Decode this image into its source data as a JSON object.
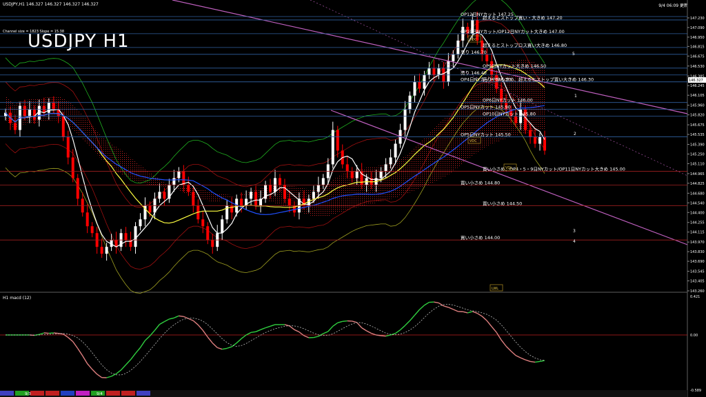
{
  "header": {
    "symbol_line": "USDJPY,H1  146.327 146.327 146.327 146.327",
    "clock": "9/4 06:09 更新",
    "channel_info": "Channel size = 1823 Slope = 15.38",
    "title": "USDJPY H1"
  },
  "macd": {
    "label": "H1  macd (12)",
    "ticks": [
      "0.421",
      "0.00",
      "-0.589"
    ]
  },
  "dates": [
    "9/3",
    "9/4"
  ],
  "colors": {
    "bg": "#000000",
    "bull": "#ffffff",
    "bear": "#ff0000",
    "ma_white": "#ffffff",
    "ma_yellow": "#ffff40",
    "ma_blue": "#2050ff",
    "bb": "#a01010",
    "green": "#20b020",
    "channel": "#c060c0",
    "cloud": "#c02020"
  },
  "chart_data": {
    "type": "line",
    "title": "USDJPY H1",
    "y_axis_ticks": [
      "147.230",
      "147.090",
      "146.950",
      "146.815",
      "146.675",
      "146.530",
      "146.385",
      "146.245",
      "146.105",
      "145.960",
      "145.820",
      "145.675",
      "145.535",
      "145.390",
      "145.250",
      "145.110",
      "144.965",
      "144.825",
      "144.680",
      "144.540",
      "144.400",
      "144.255",
      "144.115",
      "143.970",
      "143.830",
      "143.690",
      "143.545",
      "143.405",
      "143.260"
    ],
    "current_price": "146.327",
    "ylim": [
      143.26,
      147.37
    ],
    "candles_close": [
      145.85,
      145.7,
      145.6,
      145.95,
      145.8,
      145.9,
      145.75,
      145.95,
      145.85,
      146.0,
      145.9,
      145.8,
      145.5,
      145.2,
      144.9,
      144.6,
      144.4,
      144.2,
      144.1,
      143.9,
      143.8,
      143.9,
      144.0,
      143.9,
      144.1,
      144.0,
      143.9,
      144.2,
      144.3,
      144.5,
      144.4,
      144.6,
      144.7,
      144.6,
      144.8,
      144.9,
      145.0,
      144.8,
      144.7,
      144.5,
      144.3,
      144.2,
      144.0,
      143.9,
      144.1,
      144.3,
      144.5,
      144.4,
      144.6,
      144.5,
      144.6,
      144.7,
      144.5,
      144.6,
      144.8,
      144.7,
      144.9,
      144.8,
      144.6,
      144.5,
      144.4,
      144.6,
      144.5,
      144.6,
      144.7,
      144.8,
      144.9,
      145.1,
      145.6,
      145.3,
      145.1,
      145.0,
      144.9,
      145.0,
      144.8,
      144.9,
      144.8,
      144.9,
      145.0,
      145.1,
      145.2,
      145.4,
      145.6,
      145.9,
      146.1,
      146.3,
      146.2,
      146.4,
      146.5,
      146.4,
      146.5,
      146.3,
      146.6,
      146.7,
      146.9,
      147.1,
      147.0,
      147.2,
      146.9,
      146.7,
      146.6,
      146.4,
      146.2,
      146.0,
      145.9,
      145.8,
      145.7,
      145.9,
      145.6,
      145.5,
      145.4,
      145.5,
      145.3
    ],
    "levels": [
      {
        "price": 147.25,
        "label": "OP12日NYカット 147.25"
      },
      {
        "price": 147.2,
        "label": "超えるとストップ買い・大きめ 147.20"
      },
      {
        "price": 147.0,
        "label": "OP10日NYカット/OP12日NYカット大きめ 147.00"
      },
      {
        "price": 146.8,
        "label": "超えるとストップロス買い大きめ 146.80"
      },
      {
        "price": 146.7,
        "label": "売り 146.70"
      },
      {
        "price": 146.5,
        "label": "OP9日NYカット大きめ 146.50"
      },
      {
        "price": 146.4,
        "label": "売り 146.40"
      },
      {
        "price": 146.3,
        "label": "売りやや小さめ、超えるとストップ買い大きめ 146.30"
      },
      {
        "price": 146.3,
        "label": "OP4日NYカット 146.30"
      },
      {
        "price": 146.0,
        "label": "OP6日NYカット 146.00"
      },
      {
        "price": 145.9,
        "label": "OP5日NYカット 145.90"
      },
      {
        "price": 145.8,
        "label": "OP10日NYカット 145.80"
      },
      {
        "price": 145.5,
        "label": "OP5日NYカット 145.50"
      },
      {
        "price": 145.0,
        "label": "買い小さめ、OP4・5・9日NYカット/OP11日NYカット大きめ 145.00"
      },
      {
        "price": 144.8,
        "label": "買い小さめ 144.80"
      },
      {
        "price": 144.5,
        "label": "買い小さめ 144.50"
      },
      {
        "price": 144.0,
        "label": "買い小さめ 144.00"
      }
    ],
    "wave_labels": [
      "5",
      "1",
      "2",
      "3",
      "4"
    ],
    "box_labels": [
      "VDC",
      "VDC",
      "VDL",
      "LWL"
    ]
  }
}
